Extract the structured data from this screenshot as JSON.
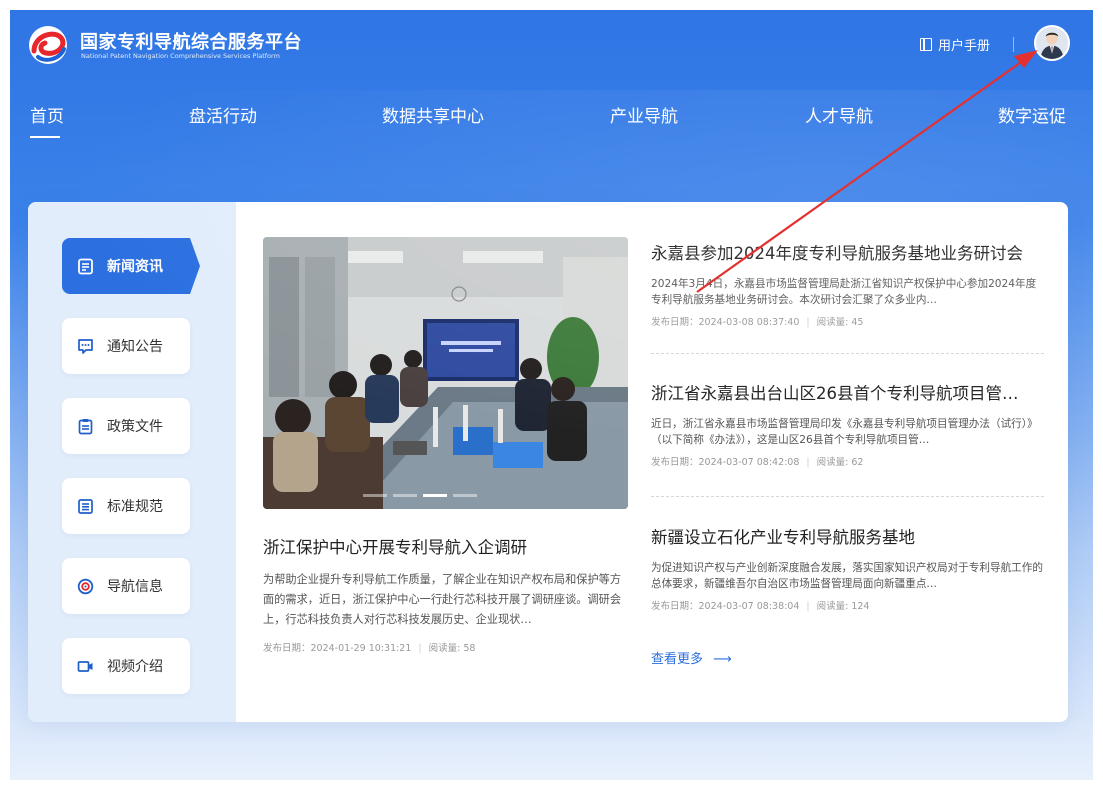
{
  "brand": {
    "title_cn": "国家专利导航综合服务平台",
    "title_en": "National Patent Navigation Comprehensive Services Platform"
  },
  "header": {
    "user_manual": "用户手册"
  },
  "nav": {
    "items": [
      {
        "label": "首页"
      },
      {
        "label": "盘活行动"
      },
      {
        "label": "数据共享中心"
      },
      {
        "label": "产业导航"
      },
      {
        "label": "人才导航"
      },
      {
        "label": "数字运促"
      }
    ],
    "active": "首页"
  },
  "sidebar": {
    "items": [
      {
        "label": "新闻资讯",
        "icon": "document-icon",
        "active": true
      },
      {
        "label": "通知公告",
        "icon": "message-icon"
      },
      {
        "label": "政策文件",
        "icon": "clipboard-icon"
      },
      {
        "label": "标准规范",
        "icon": "list-icon"
      },
      {
        "label": "导航信息",
        "icon": "target-icon"
      },
      {
        "label": "视频介绍",
        "icon": "video-icon"
      }
    ]
  },
  "feature": {
    "title": "浙江保护中心开展专利导航入企调研",
    "summary": "为帮助企业提升专利导航工作质量，了解企业在知识产权布局和保护等方面的需求，近日，浙江保护中心一行赴行芯科技开展了调研座谈。调研会上，行芯科技负责人对行芯科技发展历史、企业现状…",
    "date": "发布日期：2024-01-29 10:31:21",
    "reads": "阅读量: 58"
  },
  "news": [
    {
      "title": "永嘉县参加2024年度专利导航服务基地业务研讨会",
      "summary": "2024年3月4日，永嘉县市场监督管理局赴浙江省知识产权保护中心参加2024年度专利导航服务基地业务研讨会。本次研讨会汇聚了众多业内…",
      "date": "发布日期：2024-03-08 08:37:40",
      "reads": "阅读量: 45"
    },
    {
      "title": "浙江省永嘉县出台山区26县首个专利导航项目管…",
      "summary": "近日，浙江省永嘉县市场监督管理局印发《永嘉县专利导航项目管理办法（试行）》（以下简称《办法》），这是山区26县首个专利导航项目管…",
      "date": "发布日期：2024-03-07 08:42:08",
      "reads": "阅读量: 62"
    },
    {
      "title": "新疆设立石化产业专利导航服务基地",
      "summary": "为促进知识产权与产业创新深度融合发展，落实国家知识产权局对于专利导航工作的总体要求，新疆维吾尔自治区市场监督管理局面向新疆重点…",
      "date": "发布日期：2024-03-07 08:38:04",
      "reads": "阅读量: 124"
    }
  ],
  "more": "查看更多",
  "carousel": {
    "count": 4,
    "active": 2
  },
  "colors": {
    "primary": "#2b6fe0",
    "annotation_arrow": "#e53030"
  }
}
